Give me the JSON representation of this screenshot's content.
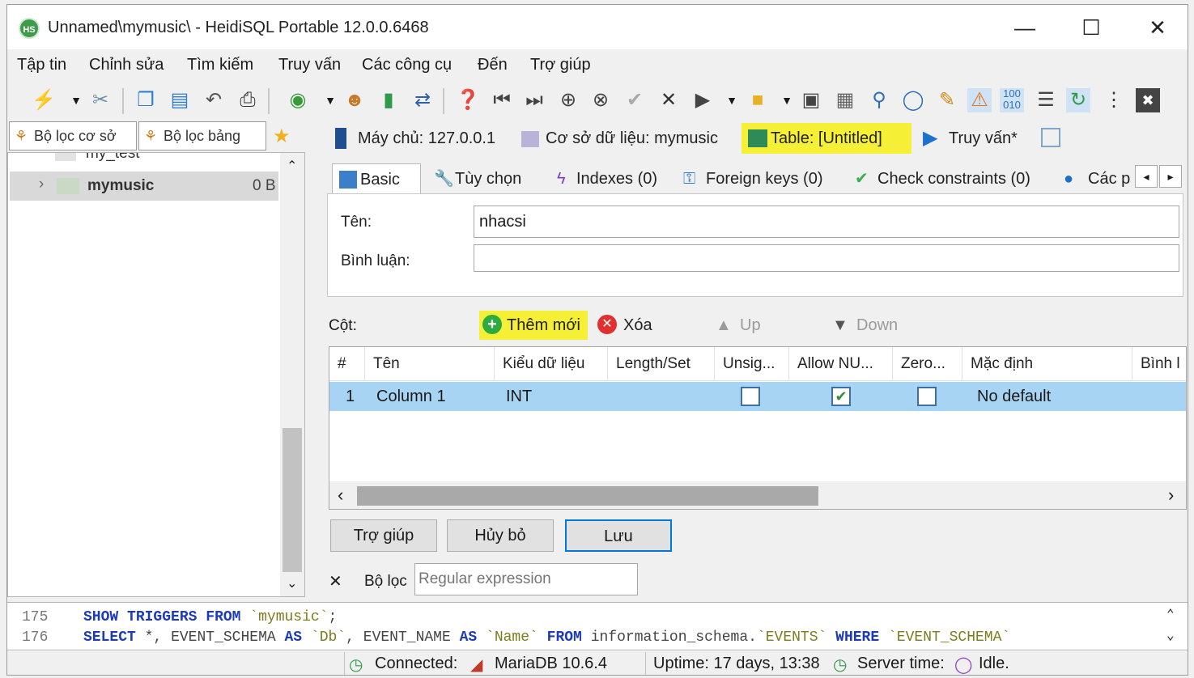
{
  "window": {
    "title": "Unnamed\\mymusic\\ - HeidiSQL Portable 12.0.0.6468",
    "app_icon_text": "HS",
    "controls": {
      "minimize": "—",
      "maximize": "☐",
      "close": "✕"
    }
  },
  "menu": [
    "Tập tin",
    "Chỉnh sửa",
    "Tìm kiếm",
    "Truy vấn",
    "Các công cụ",
    "Đến",
    "Trợ giúp"
  ],
  "toolbar": {
    "icons": [
      "connect-icon",
      "dropdown-icon",
      "disconnect-icon",
      "copy-icon",
      "paste-icon",
      "undo-icon",
      "print-icon",
      "refresh-icon",
      "dropdown-icon",
      "users-icon",
      "export-icon",
      "transfer-icon",
      "help-icon",
      "first-icon",
      "last-icon",
      "add-icon",
      "cancel-icon",
      "confirm-icon",
      "delete-icon",
      "run-icon",
      "dropdown-icon",
      "folder-icon",
      "dropdown-icon",
      "save-icon",
      "save-as-icon",
      "find-icon",
      "find-replace-icon",
      "clean-icon",
      "warning-icon",
      "binary-icon",
      "wrap-icon",
      "auto-refresh-icon",
      "more-icon",
      "exit-icon"
    ]
  },
  "left_panel": {
    "filter_db_label": "Bộ lọc cơ sở",
    "filter_table_label": "Bộ lọc bảng",
    "tree": {
      "partial_item": "my_test",
      "selected_item": "mymusic",
      "selected_item_size": "0 B"
    }
  },
  "object_tabs": {
    "host": "Máy chủ: 127.0.0.1",
    "database": "Cơ sở dữ liệu: mymusic",
    "table": "Table: [Untitled]",
    "query": "Truy vấn*"
  },
  "editor": {
    "tabs": [
      "Basic",
      "Tùy chọn",
      "Indexes (0)",
      "Foreign keys (0)",
      "Check constraints (0)",
      "Các p"
    ],
    "name_label": "Tên:",
    "name_value": "nhacsi",
    "comment_label": "Bình luận:",
    "comment_value": "",
    "columns_label": "Cột:",
    "add_label": "Thêm mới",
    "delete_label": "Xóa",
    "up_label": "Up",
    "down_label": "Down",
    "grid": {
      "headers": [
        "#",
        "Tên",
        "Kiểu dữ liệu",
        "Length/Set",
        "Unsig...",
        "Allow NU...",
        "Zero...",
        "Mặc định",
        "Bình l"
      ],
      "rows": [
        {
          "num": "1",
          "name": "Column 1",
          "type": "INT",
          "length": "",
          "unsigned": false,
          "allow_null": true,
          "zerofill": false,
          "default": "No default"
        }
      ],
      "scroll_left": "‹",
      "scroll_right": "›"
    },
    "buttons": {
      "help": "Trợ giúp",
      "cancel": "Hủy bỏ",
      "save": "Lưu"
    }
  },
  "filter_bar": {
    "close": "✕",
    "label": "Bộ lọc",
    "placeholder": "Regular expression"
  },
  "sql_log": {
    "lines": [
      {
        "num": "175",
        "text": "SHOW TRIGGERS FROM `mymusic`;"
      },
      {
        "num": "176",
        "text": "SELECT *, EVENT_SCHEMA AS `Db`, EVENT_NAME AS `Name` FROM information_schema.`EVENTS` WHERE `EVENT_SCHEMA`"
      }
    ]
  },
  "status": {
    "connected": "Connected:",
    "server": "MariaDB 10.6.4",
    "uptime": "Uptime: 17 days, 13:38",
    "server_time": "Server time:",
    "state": "Idle."
  },
  "colors": {
    "highlight": "#f5ef36",
    "selection": "#a8d4f3",
    "sql_keyword": "#1d3bb8"
  }
}
